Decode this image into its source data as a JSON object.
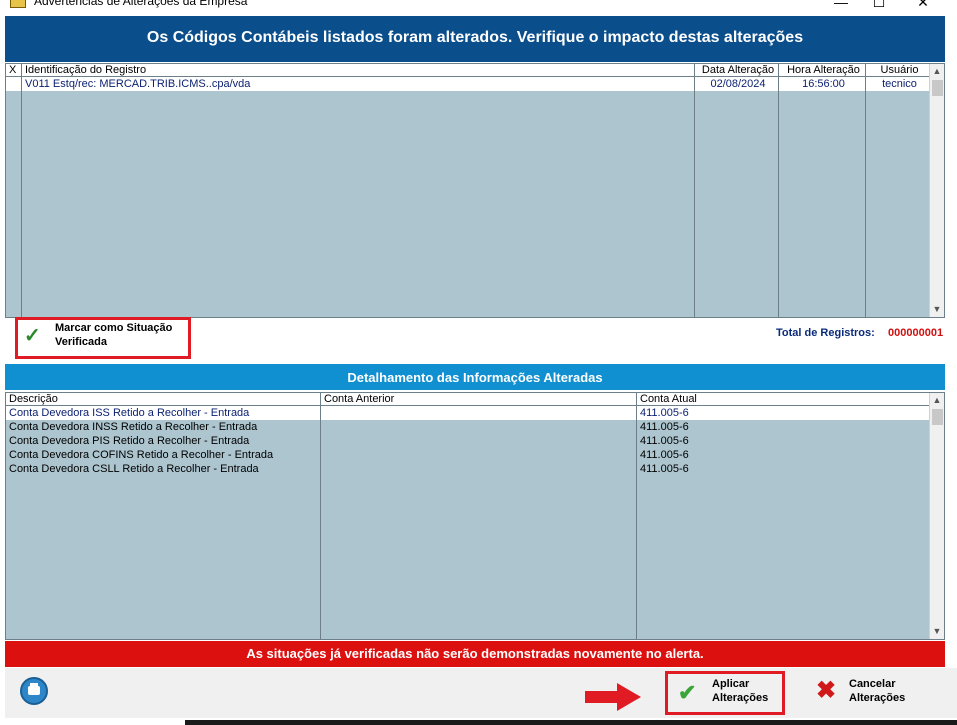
{
  "window": {
    "title": "Advertências de Alterações da Empresa",
    "minimize": "—",
    "maximize": "☐",
    "close": "✕"
  },
  "header": {
    "message": "Os Códigos Contábeis listados foram alterados. Verifique o impacto destas alterações"
  },
  "records": {
    "columns": [
      "X",
      "Identificação do Registro",
      "Data Alteração",
      "Hora Alteração",
      "Usuário"
    ],
    "rows": [
      {
        "x": "",
        "id": "V011 Estq/rec: MERCAD.TRIB.ICMS..cpa/vda",
        "date": "02/08/2024",
        "time": "16:56:00",
        "user": "tecnico"
      }
    ]
  },
  "verified": {
    "label": "Marcar como Situação Verificada",
    "total_label": "Total de Registros:",
    "total_value": "000000001"
  },
  "detail": {
    "title": "Detalhamento das Informações Alteradas",
    "columns": [
      "Descrição",
      "Conta Anterior",
      "Conta Atual"
    ],
    "rows": [
      {
        "desc": "Conta Devedora ISS Retido a Recolher - Entrada",
        "prev": "",
        "curr": "411.005-6"
      },
      {
        "desc": "Conta Devedora INSS Retido a Recolher - Entrada",
        "prev": "",
        "curr": "411.005-6"
      },
      {
        "desc": "Conta Devedora PIS Retido a Recolher - Entrada",
        "prev": "",
        "curr": "411.005-6"
      },
      {
        "desc": "Conta Devedora COFINS Retido a Recolher - Entrada",
        "prev": "",
        "curr": "411.005-6"
      },
      {
        "desc": "Conta Devedora CSLL Retido a Recolher - Entrada",
        "prev": "",
        "curr": "411.005-6"
      }
    ]
  },
  "warning": "As situações já verificadas não serão demonstradas novamente no alerta.",
  "footer": {
    "print_icon": "printer-icon",
    "apply_line1": "Aplicar",
    "apply_line2": "Alterações",
    "cancel_line1": "Cancelar",
    "cancel_line2": "Alterações"
  },
  "colors": {
    "header_bg": "#0b4e8c",
    "grid_bg": "#adc5cf",
    "detail_bg": "#1090d0",
    "warning_bg": "#dd1010",
    "highlight": "#e01b24"
  }
}
